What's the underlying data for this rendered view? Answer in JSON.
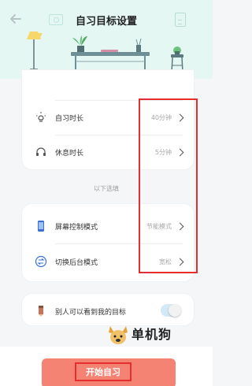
{
  "header": {
    "title": "自习目标设置",
    "bg_color": "#e4f7f3"
  },
  "settings_top": [
    {
      "label": "自习时长",
      "value": "40分钟",
      "icon": "lamp-icon"
    },
    {
      "label": "休息时长",
      "value": "5分钟",
      "icon": "headphones-icon"
    }
  ],
  "section_label": "以下选填",
  "settings_mid": [
    {
      "label": "屏幕控制模式",
      "value": "节能模式",
      "icon": "phone-icon"
    },
    {
      "label": "切换后台模式",
      "value": "宽松",
      "icon": "switch-icon"
    }
  ],
  "visibility": {
    "label": "别人可以看到我的目标",
    "icon": "pencil-icon"
  },
  "start_button": {
    "label": "开始自习",
    "color": "#f58373"
  },
  "watermark": {
    "text": "单机狗"
  },
  "annotation_color": "#e52e2e"
}
